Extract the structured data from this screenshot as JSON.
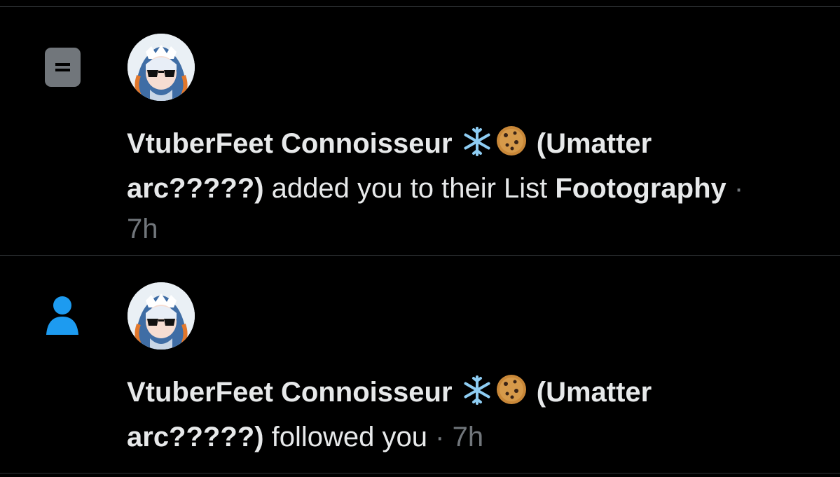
{
  "notifications": [
    {
      "type_icon": "list-icon",
      "avatar_icon": "avatar-image",
      "user_name_part1": "VtuberFeet Connoisseur",
      "emoji1": "snowflake-icon",
      "emoji2": "cookie-icon",
      "user_name_part2": "(Umatter",
      "user_name_part3": "arc?????)",
      "action": " added you to their List ",
      "list_name": "Footography",
      "separator": " ·",
      "time": "7h"
    },
    {
      "type_icon": "person-icon",
      "avatar_icon": "avatar-image",
      "user_name_part1": "VtuberFeet Connoisseur",
      "emoji1": "snowflake-icon",
      "emoji2": "cookie-icon",
      "user_name_part2": "(Umatter",
      "user_name_part3": "arc?????)",
      "action": " followed you",
      "separator": " · ",
      "time": "7h"
    }
  ],
  "colors": {
    "background": "#000000",
    "text": "#e7e9ea",
    "muted": "#71767b",
    "divider": "#2f3336",
    "follow_icon": "#1d9bf0",
    "list_icon": "#71767b"
  }
}
